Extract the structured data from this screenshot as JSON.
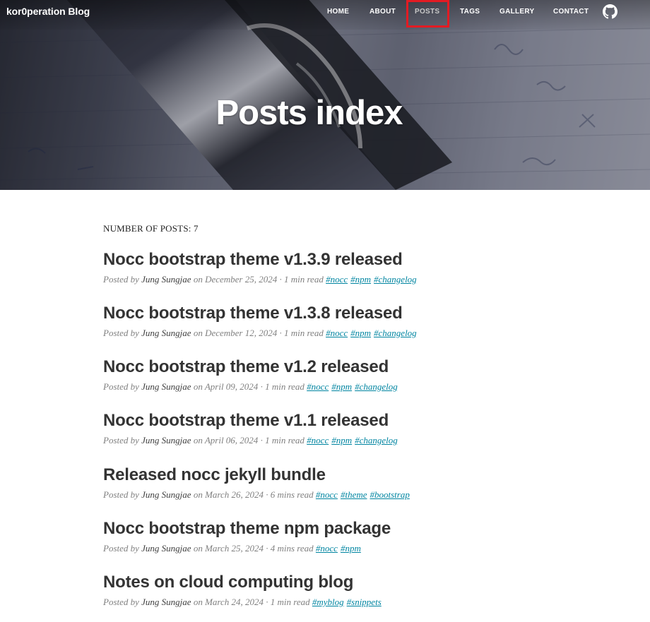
{
  "nav": {
    "brand": "kor0peration Blog",
    "items": [
      {
        "label": "HOME"
      },
      {
        "label": "ABOUT"
      },
      {
        "label": "POSTS"
      },
      {
        "label": "TAGS"
      },
      {
        "label": "GALLERY"
      },
      {
        "label": "CONTACT"
      }
    ],
    "active": "POSTS",
    "github_icon": "github-icon"
  },
  "hero": {
    "title": "Posts index"
  },
  "posts_count_label": "NUMBER OF POSTS: 7",
  "posts": [
    {
      "title": "Nocc bootstrap theme v1.3.9 released",
      "posted_by": "Posted by",
      "author": "Jung Sungjae",
      "date_prefix": "on",
      "date": "December 25, 2024",
      "read": "· 1 min read",
      "tags": [
        "#nocc",
        "#npm",
        "#changelog"
      ]
    },
    {
      "title": "Nocc bootstrap theme v1.3.8 released",
      "posted_by": "Posted by",
      "author": "Jung Sungjae",
      "date_prefix": "on",
      "date": "December 12, 2024",
      "read": "· 1 min read",
      "tags": [
        "#nocc",
        "#npm",
        "#changelog"
      ]
    },
    {
      "title": "Nocc bootstrap theme v1.2 released",
      "posted_by": "Posted by",
      "author": "Jung Sungjae",
      "date_prefix": "on",
      "date": "April 09, 2024",
      "read": "· 1 min read",
      "tags": [
        "#nocc",
        "#npm",
        "#changelog"
      ]
    },
    {
      "title": "Nocc bootstrap theme v1.1 released",
      "posted_by": "Posted by",
      "author": "Jung Sungjae",
      "date_prefix": "on",
      "date": "April 06, 2024",
      "read": "· 1 min read",
      "tags": [
        "#nocc",
        "#npm",
        "#changelog"
      ]
    },
    {
      "title": "Released nocc jekyll bundle",
      "posted_by": "Posted by",
      "author": "Jung Sungjae",
      "date_prefix": "on",
      "date": "March 26, 2024",
      "read": "· 6 mins read",
      "tags": [
        "#nocc",
        "#theme",
        "#bootstrap"
      ]
    },
    {
      "title": "Nocc bootstrap theme npm package",
      "posted_by": "Posted by",
      "author": "Jung Sungjae",
      "date_prefix": "on",
      "date": "March 25, 2024",
      "read": "· 4 mins read",
      "tags": [
        "#nocc",
        "#npm"
      ]
    },
    {
      "title": "Notes on cloud computing blog",
      "posted_by": "Posted by",
      "author": "Jung Sungjae",
      "date_prefix": "on",
      "date": "March 24, 2024",
      "read": "· 1 min read",
      "tags": [
        "#myblog",
        "#snippets"
      ]
    }
  ],
  "colors": {
    "tag_link": "#0085a1",
    "active_highlight": "#e31b23"
  }
}
